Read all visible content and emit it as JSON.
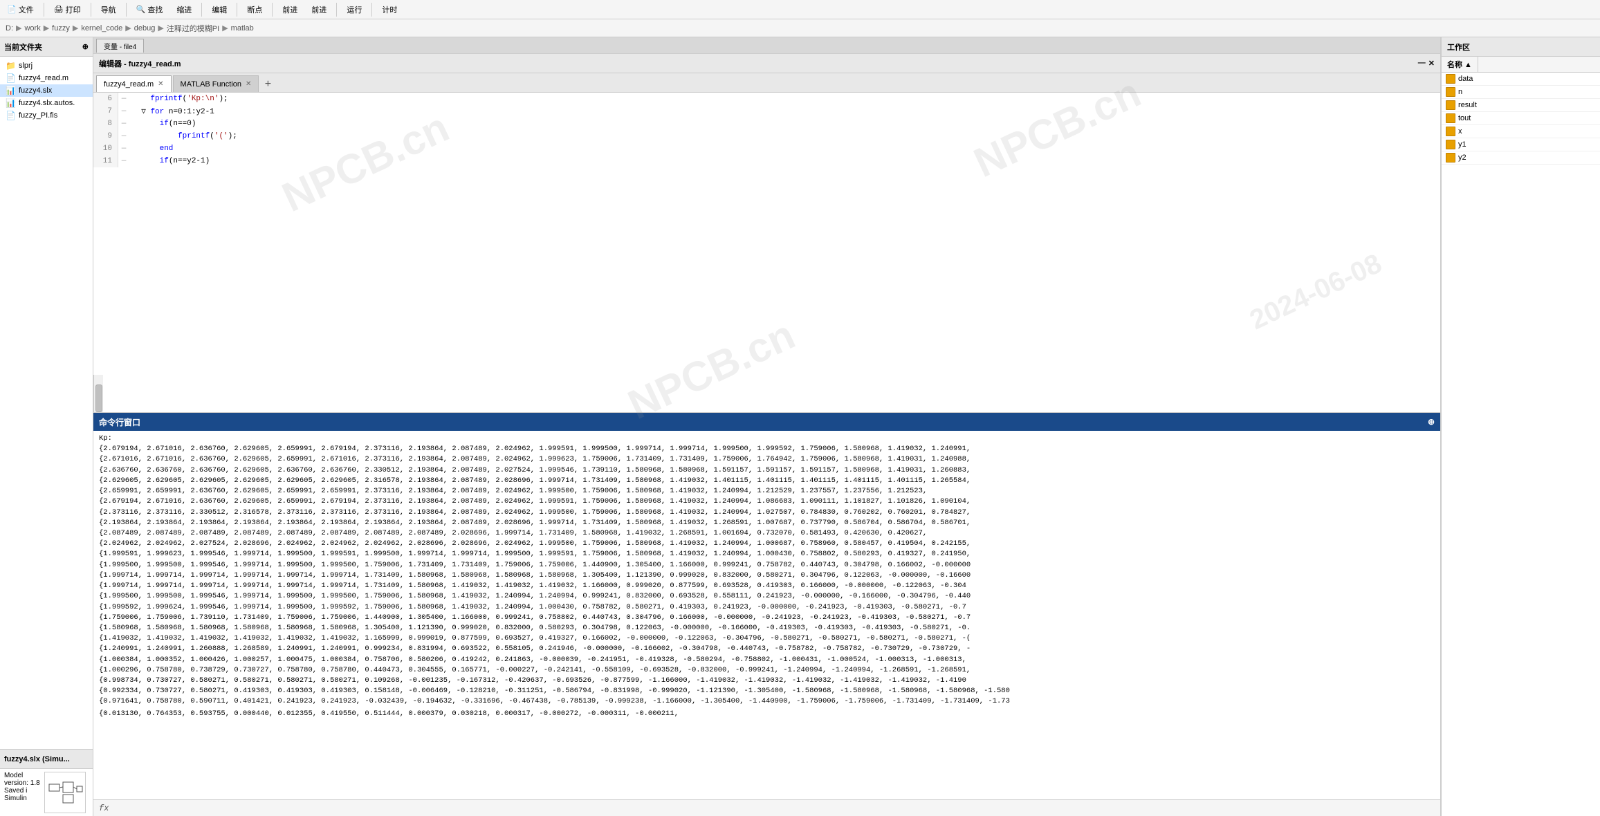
{
  "toolbar": {
    "buttons": [
      "文件",
      "导航",
      "编辑",
      "断点",
      "运行"
    ],
    "print_label": "打印",
    "find_label": "查找",
    "zoom_in_label": "缩进",
    "forward_label": "前进",
    "back_label": "前进",
    "timer_label": "计时"
  },
  "path_bar": {
    "items": [
      "D:",
      "work",
      "fuzzy",
      "kernel_code",
      "debug",
      "注释过的模糊PI",
      "matlab"
    ]
  },
  "left_panel": {
    "header": "当前文件夹",
    "files": [
      {
        "name": "slprj",
        "type": "folder"
      },
      {
        "name": "fuzzy4_read.m",
        "type": "m"
      },
      {
        "name": "fuzzy4.slx",
        "type": "slx",
        "selected": true
      },
      {
        "name": "fuzzy4.slx.autos.",
        "type": "slx"
      },
      {
        "name": "fuzzy_PI.fis",
        "type": "fis"
      }
    ]
  },
  "editor": {
    "title": "编辑器 - fuzzy4_read.m",
    "tabs": [
      {
        "label": "fuzzy4_read.m",
        "active": true
      },
      {
        "label": "MATLAB Function",
        "active": false
      }
    ],
    "variable_tab": "变量 - file4",
    "lines": [
      {
        "num": "6",
        "dash": "—",
        "content": "    fprintf('Kp:\\n');"
      },
      {
        "num": "7",
        "dash": "—",
        "content": "  for n=0:1:y2-1",
        "has_loop": true
      },
      {
        "num": "8",
        "dash": "—",
        "content": "      if(n==0)"
      },
      {
        "num": "9",
        "dash": "—",
        "content": "          fprintf('(');"
      },
      {
        "num": "10",
        "dash": "—",
        "content": "      end"
      },
      {
        "num": "11",
        "dash": "—",
        "content": "      if(n==y2-1)"
      }
    ]
  },
  "cmd_window": {
    "title": "命令行窗口",
    "label_kp": "Kp:",
    "rows": [
      "{2.679194, 2.671016, 2.636760, 2.629605, 2.659991, 2.679194, 2.373116, 2.193864, 2.087489, 2.024962, 1.999591, 1.999500, 1.999714, 1.999714, 1.999500, 1.999592, 1.759006, 1.580968, 1.419032, 1.240991,",
      "{2.671016, 2.671016, 2.636760, 2.629605, 2.659991, 2.671016, 2.373116, 2.193864, 2.087489, 2.024962, 1.999623, 1.759006, 1.731409, 1.731409, 1.759006, 1.764942, 1.759006, 1.580968, 1.419031, 1.240988,",
      "{2.636760, 2.636760, 2.636760, 2.629605, 2.636760, 2.636760, 2.330512, 2.193864, 2.087489, 2.027524, 1.999546, 1.739110, 1.580968, 1.580968, 1.591157, 1.591157, 1.591157, 1.580968, 1.419031, 1.260883,",
      "{2.629605, 2.629605, 2.629605, 2.629605, 2.629605, 2.629605, 2.316578, 2.193864, 2.087489, 2.028696, 1.999714, 1.731409, 1.580968, 1.419032, 1.401115, 1.401115, 1.401115, 1.401115, 1.401115, 1.265584,",
      "{2.659991, 2.659991, 2.636760, 2.629605, 2.659991, 2.659991, 2.373116, 2.193864, 2.087489, 2.024962, 1.999500, 1.759006, 1.580968, 1.419032, 1.240994, 1.212529, 1.237557, 1.237556, 1.212523,",
      "{2.679194, 2.671016, 2.636760, 2.629605, 2.659991, 2.679194, 2.373116, 2.193864, 2.087489, 2.024962, 1.999591, 1.759006, 1.580968, 1.419032, 1.240994, 1.086683, 1.090111, 1.101827, 1.101826, 1.090104,",
      "{2.373116, 2.373116, 2.330512, 2.316578, 2.373116, 2.373116, 2.373116, 2.193864, 2.087489, 2.024962, 1.999500, 1.759006, 1.580968, 1.419032, 1.240994, 1.027507, 0.784830, 0.760202, 0.760201, 0.784827,",
      "{2.193864, 2.193864, 2.193864, 2.193864, 2.193864, 2.193864, 2.193864, 2.193864, 2.087489, 2.028696, 1.999714, 1.731409, 1.580968, 1.419032, 1.268591, 1.007687, 0.737790, 0.586704, 0.586704, 0.586701,",
      "{2.087489, 2.087489, 2.087489, 2.087489, 2.087489, 2.087489, 2.087489, 2.087489, 2.028696, 1.999714, 1.731409, 1.580968, 1.419032, 1.268591, 1.001694, 0.732070, 0.581493, 0.420630, 0.420627,",
      "{2.024962, 2.024962, 2.027524, 2.028696, 2.024962, 2.024962, 2.024962, 2.028696, 2.028696, 2.024962, 1.999500, 1.759006, 1.580968, 1.419032, 1.240994, 1.000687, 0.758960, 0.580457, 0.419504, 0.242155,",
      "{1.999591, 1.999623, 1.999546, 1.999714, 1.999500, 1.999591, 1.999500, 1.999714, 1.999714, 1.999500, 1.999591, 1.759006, 1.580968, 1.419032, 1.240994, 1.000430, 0.758802, 0.580293, 0.419327, 0.241950,",
      "{1.999500, 1.999500, 1.999546, 1.999714, 1.999500, 1.999500, 1.759006, 1.731409, 1.731409, 1.759006, 1.759006, 1.440900, 1.305400, 1.166000, 0.999241, 0.758782, 0.440743, 0.304798, 0.166002, -0.000000",
      "{1.999714, 1.999714, 1.999714, 1.999714, 1.999714, 1.999714, 1.731409, 1.580968, 1.580968, 1.580968, 1.580968, 1.305400, 1.121390, 0.999020, 0.832000, 0.580271, 0.304796, 0.122063, -0.000000, -0.16600",
      "{1.999714, 1.999714, 1.999714, 1.999714, 1.999714, 1.999714, 1.731409, 1.580968, 1.419032, 1.419032, 1.419032, 1.166000, 0.999020, 0.877599, 0.693528, 0.419303, 0.166000, -0.000000, -0.122063, -0.304",
      "{1.999500, 1.999500, 1.999546, 1.999714, 1.999500, 1.999500, 1.759006, 1.580968, 1.419032, 1.240994, 1.240994, 0.999241, 0.832000, 0.693528, 0.558111, 0.241923, -0.000000, -0.166000, -0.304796, -0.440",
      "{1.999592, 1.999624, 1.999546, 1.999714, 1.999500, 1.999592, 1.759006, 1.580968, 1.419032, 1.240994, 1.000430, 0.758782, 0.580271, 0.419303, 0.241923, -0.000000, -0.241923, -0.419303, -0.580271, -0.7",
      "{1.759006, 1.759006, 1.739110, 1.731409, 1.759006, 1.759006, 1.440900, 1.305400, 1.166000, 0.999241, 0.758802, 0.440743, 0.304796, 0.166000, -0.000000, -0.241923, -0.241923, -0.419303, -0.580271, -0.7",
      "{1.580968, 1.580968, 1.580968, 1.580968, 1.580968, 1.580968, 1.305400, 1.121390, 0.999020, 0.832000, 0.580293, 0.304798, 0.122063, -0.000000, -0.166000, -0.419303, -0.419303, -0.419303, -0.580271, -0.",
      "{1.419032, 1.419032, 1.419032, 1.419032, 1.419032, 1.419032, 1.165999, 0.999019, 0.877599, 0.693527, 0.419327, 0.166002, -0.000000, -0.122063, -0.304796, -0.580271, -0.580271, -0.580271, -0.580271, -(",
      "{1.240991, 1.240991, 1.260888, 1.268589, 1.240991, 1.240991, 0.999234, 0.831994, 0.693522, 0.558105, 0.241946, -0.000000, -0.166002, -0.304798, -0.440743, -0.758782, -0.758782, -0.730729, -0.730729, -",
      "{1.000384, 1.000352, 1.000426, 1.000257, 1.000475, 1.000384, 0.758706, 0.580206, 0.419242, 0.241863, -0.000039, -0.241951, -0.419328, -0.580294, -0.758802, -1.000431, -1.000524, -1.000313, -1.000313,",
      "{1.000296, 0.758780, 0.738729, 0.730727, 0.758780, 0.758780, 0.440473, 0.304555, 0.165771, -0.000227, -0.242141, -0.558109, -0.693528, -0.832000, -0.999241, -1.240994, -1.240994, -1.268591, -1.268591,",
      "{0.998734, 0.730727, 0.580271, 0.580271, 0.580271, 0.580271, 0.109268, -0.001235, -0.167312, -0.420637, -0.693526, -0.877599, -1.166000, -1.419032, -1.419032, -1.419032, -1.419032, -1.419032, -1.4190",
      "{0.992334, 0.730727, 0.580271, 0.419303, 0.419303, 0.419303, 0.158148, -0.006469, -0.128210, -0.311251, -0.586794, -0.831998, -0.999020, -1.121390, -1.305400, -1.580968, -1.580968, -1.580968, -1.580968, -1.580",
      "{0.971641, 0.758780, 0.590711, 0.401421, 0.241923, 0.241923, -0.032439, -0.194632, -0.331696, -0.467438, -0.785139, -0.999238, -1.166000, -1.305400, -1.440900, -1.759006, -1.759006, -1.731409, -1.731409, -1.73"
    ]
  },
  "workspace": {
    "header": "工作区",
    "col_name": "名称 ▲",
    "items": [
      {
        "name": "data",
        "color": "#e8a000"
      },
      {
        "name": "n",
        "color": "#e8a000"
      },
      {
        "name": "result",
        "color": "#e8a000"
      },
      {
        "name": "tout",
        "color": "#e8a000"
      },
      {
        "name": "x",
        "color": "#e8a000"
      },
      {
        "name": "y1",
        "color": "#e8a000"
      },
      {
        "name": "y2",
        "color": "#e8a000"
      }
    ]
  },
  "bottom_model": {
    "name": "fuzzy4.slx (Simu...",
    "model_label": "Model",
    "version_label": "version:",
    "version": "1.8",
    "saved_label": "Saved i",
    "simulin_label": "Simulin"
  },
  "formula_bar": {
    "fx": "fx"
  },
  "watermark": "NPCB.cn"
}
